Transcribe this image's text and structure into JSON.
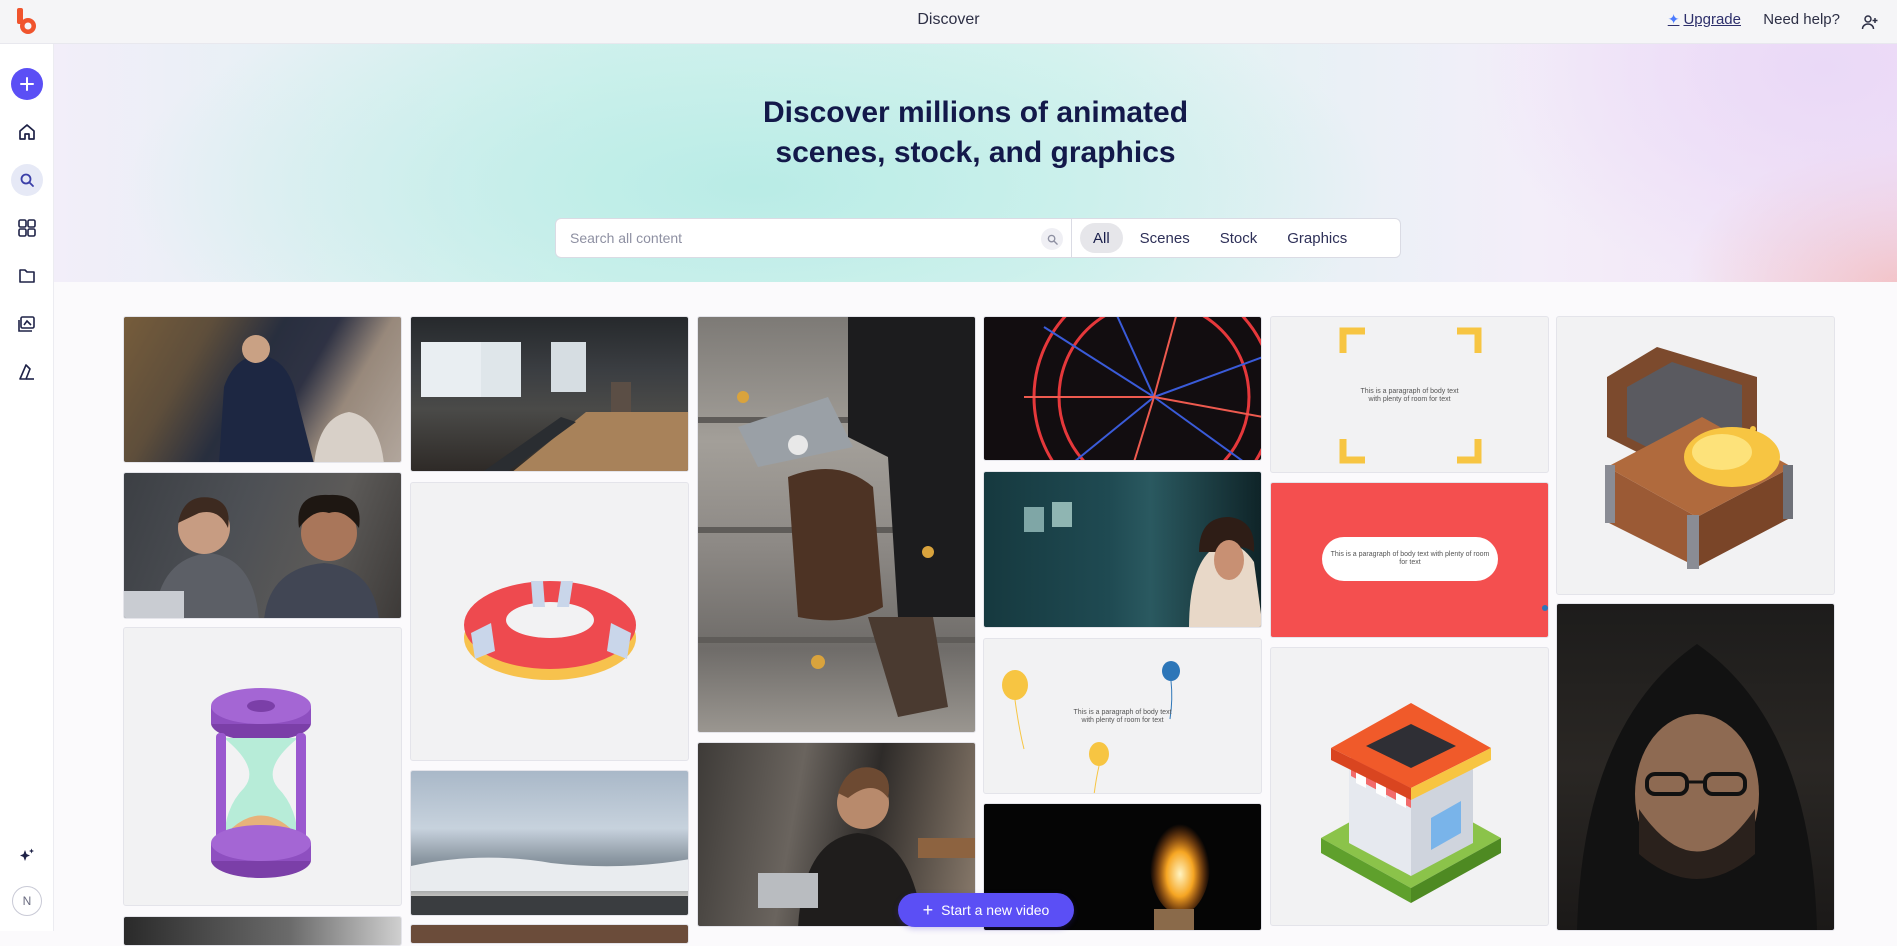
{
  "topbar": {
    "title": "Discover",
    "upgrade_label": "Upgrade",
    "help_label": "Need help?"
  },
  "sidebar": {
    "avatar_initial": "N",
    "items": [
      "create",
      "home",
      "discover",
      "templates",
      "projects",
      "brand",
      "styles",
      "ai"
    ]
  },
  "hero": {
    "title_line1": "Discover millions of animated",
    "title_line2": "scenes, stock, and graphics",
    "search_placeholder": "Search all content",
    "filters": [
      "All",
      "Scenes",
      "Stock",
      "Graphics"
    ],
    "active_filter": "All"
  },
  "cards": {
    "paragraph_text": "This is a paragraph of body text with plenty of room for text",
    "paragraph_text_a": "This is a paragraph of body text",
    "paragraph_text_b": "with plenty of room for text"
  },
  "fab": {
    "label": "Start a new video"
  },
  "colors": {
    "accent": "#5b4ff5",
    "brand": "#f0542d",
    "red_card": "#f44f4f",
    "yellow": "#f7c542"
  }
}
